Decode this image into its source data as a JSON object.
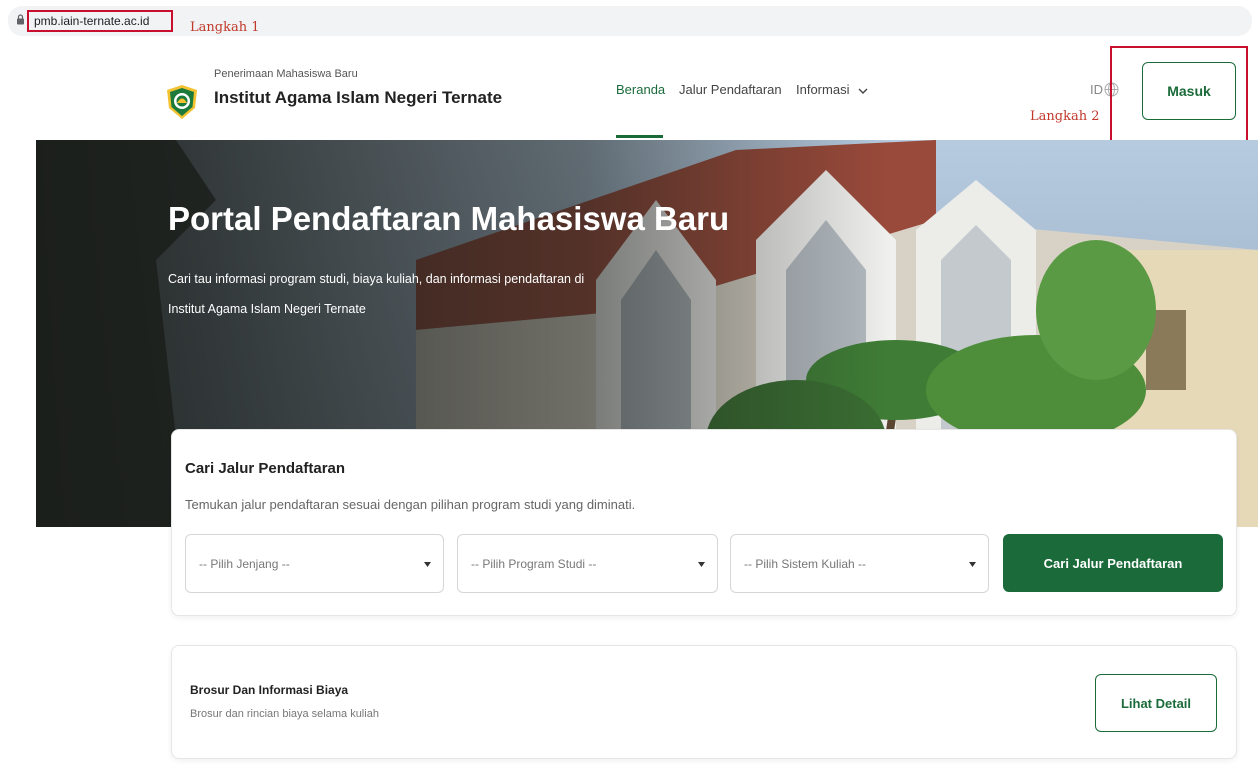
{
  "browser": {
    "url": "pmb.iain-ternate.ac.id",
    "lock_icon": "lock-icon"
  },
  "annotations": {
    "step1": "Langkah 1",
    "step2": "Langkah 2",
    "color": "#c8102e"
  },
  "header": {
    "logo_icon": "iain-ternate-logo",
    "subtitle": "Penerimaan Mahasiswa Baru",
    "title": "Institut Agama Islam Negeri Ternate",
    "nav": {
      "beranda": "Beranda",
      "jalur": "Jalur Pendaftaran",
      "informasi": "Informasi"
    },
    "lang": "ID",
    "login_label": "Masuk"
  },
  "hero": {
    "title": "Portal Pendaftaran Mahasiswa Baru",
    "line1": "Cari tau informasi program studi, biaya kuliah, dan informasi pendaftaran di",
    "line2": "Institut Agama Islam Negeri Ternate"
  },
  "search": {
    "title": "Cari Jalur Pendaftaran",
    "subtitle": "Temukan jalur pendaftaran sesuai dengan pilihan program studi yang diminati.",
    "jenjang": "-- Pilih Jenjang --",
    "prodi": "-- Pilih Program Studi --",
    "sistem": "-- Pilih Sistem Kuliah --",
    "button": "Cari Jalur Pendaftaran"
  },
  "brosur": {
    "title": "Brosur Dan Informasi Biaya",
    "subtitle": "Brosur dan rincian biaya selama kuliah",
    "button": "Lihat Detail"
  },
  "colors": {
    "primary": "#1b6b3a",
    "annotation": "#c8102e"
  }
}
